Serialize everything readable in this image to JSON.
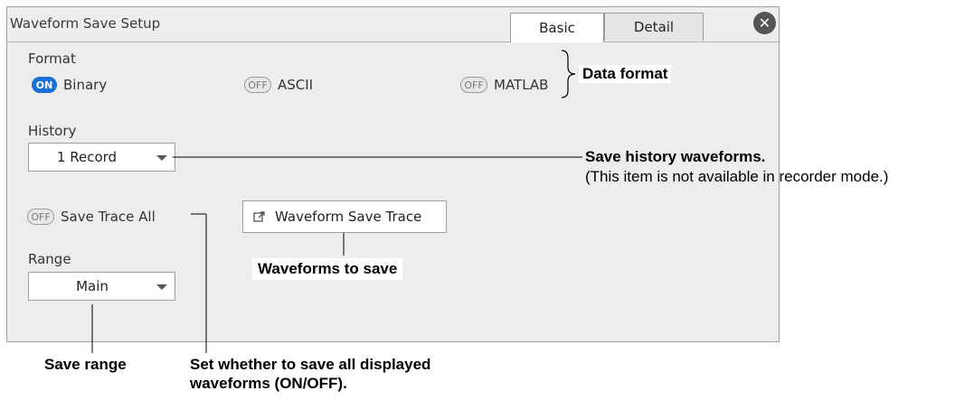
{
  "dialog": {
    "title": "Waveform Save Setup",
    "tabs": [
      "Basic",
      "Detail"
    ],
    "close_glyph": "✕"
  },
  "format": {
    "label": "Format",
    "options": [
      {
        "state": "ON",
        "label": "Binary"
      },
      {
        "state": "OFF",
        "label": "ASCII"
      },
      {
        "state": "OFF",
        "label": "MATLAB"
      }
    ]
  },
  "history": {
    "label": "History",
    "value": "1 Record"
  },
  "save_trace_all": {
    "state": "OFF",
    "label": "Save Trace All"
  },
  "trace_button": {
    "label": "Waveform Save Trace",
    "icon": "external-link-icon"
  },
  "range": {
    "label": "Range",
    "value": "Main"
  },
  "annotations": {
    "data_format": "Data format",
    "save_history": "Save history waveforms.",
    "save_history_note": "(This item is not available in recorder mode.)",
    "waveforms_to_save": "Waveforms to save",
    "save_range": "Save range",
    "save_trace_all_line1": "Set whether to save all displayed",
    "save_trace_all_line2": "waveforms (ON/OFF)."
  },
  "colors": {
    "on_pill": "#1a6fd9",
    "panel_bg": "#ededed",
    "close_button": "#555555"
  }
}
